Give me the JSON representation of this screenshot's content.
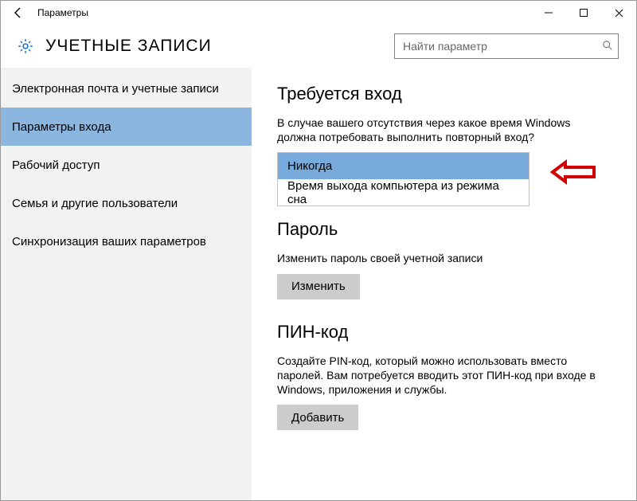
{
  "titlebar": {
    "title": "Параметры"
  },
  "header": {
    "pageTitle": "УЧЕТНЫЕ ЗАПИСИ",
    "searchPlaceholder": "Найти параметр"
  },
  "sidebar": {
    "items": [
      {
        "label": "Электронная почта и учетные записи"
      },
      {
        "label": "Параметры входа"
      },
      {
        "label": "Рабочий доступ"
      },
      {
        "label": "Семья и другие пользователи"
      },
      {
        "label": "Синхронизация ваших параметров"
      }
    ]
  },
  "content": {
    "section1": {
      "title": "Требуется вход",
      "desc": "В случае вашего отсутствия через какое время Windows должна потребовать выполнить повторный вход?",
      "options": [
        {
          "label": "Никогда",
          "selected": true
        },
        {
          "label": "Время выхода компьютера из режима сна",
          "selected": false
        }
      ]
    },
    "section2": {
      "title": "Пароль",
      "desc": "Изменить пароль своей учетной записи",
      "button": "Изменить"
    },
    "section3": {
      "title": "ПИН-код",
      "desc": "Создайте PIN-код, который можно использовать вместо паролей. Вам потребуется вводить этот ПИН-код при входе в Windows, приложения и службы.",
      "button": "Добавить"
    }
  }
}
